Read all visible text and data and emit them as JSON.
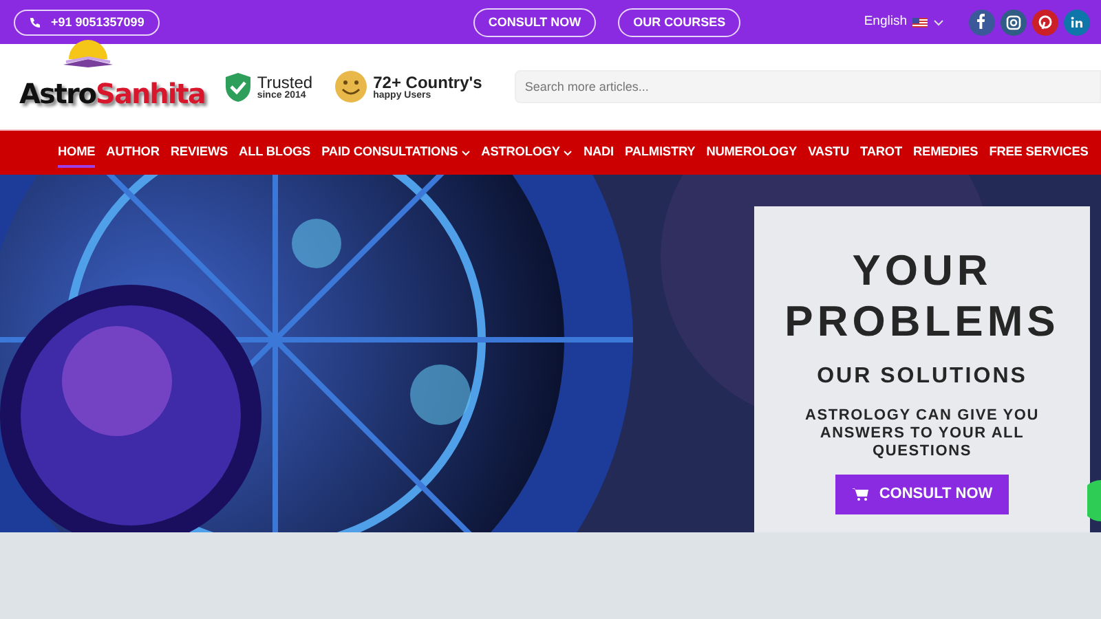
{
  "top_bar": {
    "phone": "+91 9051357099",
    "buttons": [
      "CONSULT NOW",
      "OUR COURSES"
    ],
    "language": "English"
  },
  "header": {
    "logo": {
      "part_1": "Astro",
      "part_2": "Sanhita"
    },
    "badges": [
      {
        "kind": "shield",
        "title": "Trusted",
        "subtitle": "since 2014"
      },
      {
        "kind": "smiley",
        "title": "72+ Country's",
        "subtitle": "happy Users"
      }
    ],
    "search": {
      "placeholder": "Search more articles..."
    }
  },
  "nav": [
    {
      "label": "HOME",
      "selected": true,
      "dropdown": false
    },
    {
      "label": "AUTHOR",
      "selected": false,
      "dropdown": false
    },
    {
      "label": "REVIEWS",
      "selected": false,
      "dropdown": false
    },
    {
      "label": "ALL BLOGS",
      "selected": false,
      "dropdown": false
    },
    {
      "label": "PAID CONSULTATIONS",
      "selected": false,
      "dropdown": true
    },
    {
      "label": "ASTROLOGY",
      "selected": false,
      "dropdown": true
    },
    {
      "label": "NADI",
      "selected": false,
      "dropdown": false
    },
    {
      "label": "PALMISTRY",
      "selected": false,
      "dropdown": false
    },
    {
      "label": "NUMEROLOGY",
      "selected": false,
      "dropdown": false
    },
    {
      "label": "VASTU",
      "selected": false,
      "dropdown": false
    },
    {
      "label": "TAROT",
      "selected": false,
      "dropdown": false
    },
    {
      "label": "REMEDIES",
      "selected": false,
      "dropdown": false
    },
    {
      "label": "FREE SERVICES",
      "selected": false,
      "dropdown": false
    }
  ],
  "hero": {
    "kind": "picture",
    "title_1": "YOUR",
    "title_2": "PROBLEMS",
    "subtitle": "OUR SOLUTIONS",
    "text": "ASTROLOGY CAN GIVE YOU ANSWERS TO YOUR ALL QUESTIONS",
    "button": "CONSULT NOW"
  }
}
